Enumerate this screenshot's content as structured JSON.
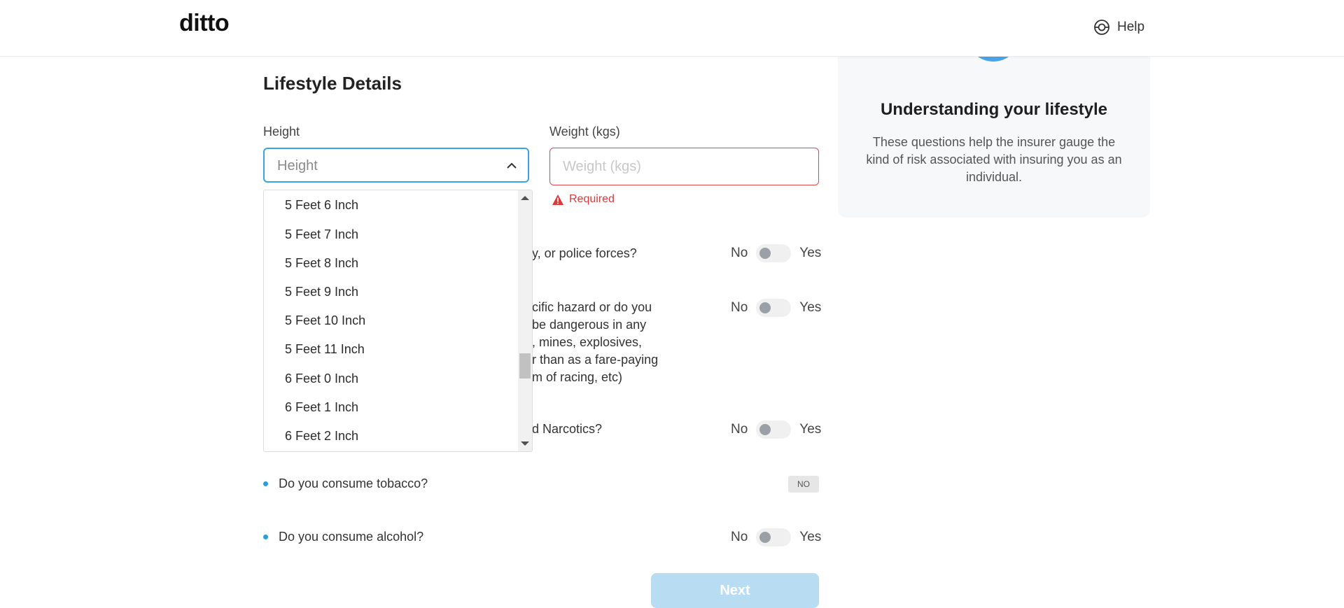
{
  "header": {
    "logo_text": "ditto",
    "help_label": "Help"
  },
  "form": {
    "section_title": "Lifestyle Details",
    "height_label": "Height",
    "height_placeholder": "Height",
    "weight_label": "Weight (kgs)",
    "weight_placeholder": "Weight (kgs)",
    "weight_error": "Required",
    "questions": [
      {
        "text_visible": "y, or police forces?",
        "no": "No",
        "yes": "Yes"
      },
      {
        "lines": [
          "cific hazard or do you",
          "be dangerous in any",
          ", mines, explosives,",
          "r than as a fare-paying",
          "m of racing, etc)"
        ],
        "no": "No",
        "yes": "Yes"
      },
      {
        "text_visible": "d Narcotics?",
        "no": "No",
        "yes": "Yes"
      },
      {
        "text": "Do you consume tobacco?",
        "badge": "NO"
      },
      {
        "text": "Do you consume alcohol?",
        "no": "No",
        "yes": "Yes"
      }
    ],
    "next_label": "Next"
  },
  "dropdown": {
    "options": [
      "5 Feet 6 Inch",
      "5 Feet 7 Inch",
      "5 Feet 8 Inch",
      "5 Feet 9 Inch",
      "5 Feet 10 Inch",
      "5 Feet 11 Inch",
      "6 Feet 0 Inch",
      "6 Feet 1 Inch",
      "6 Feet 2 Inch"
    ]
  },
  "info_card": {
    "title": "Understanding your lifestyle",
    "description": "These questions help the insurer gauge the kind of risk associated with insuring you as an individual."
  },
  "colors": {
    "accent": "#2d9cdb",
    "error": "#e0474c",
    "next_disabled": "#b8ddf3"
  }
}
